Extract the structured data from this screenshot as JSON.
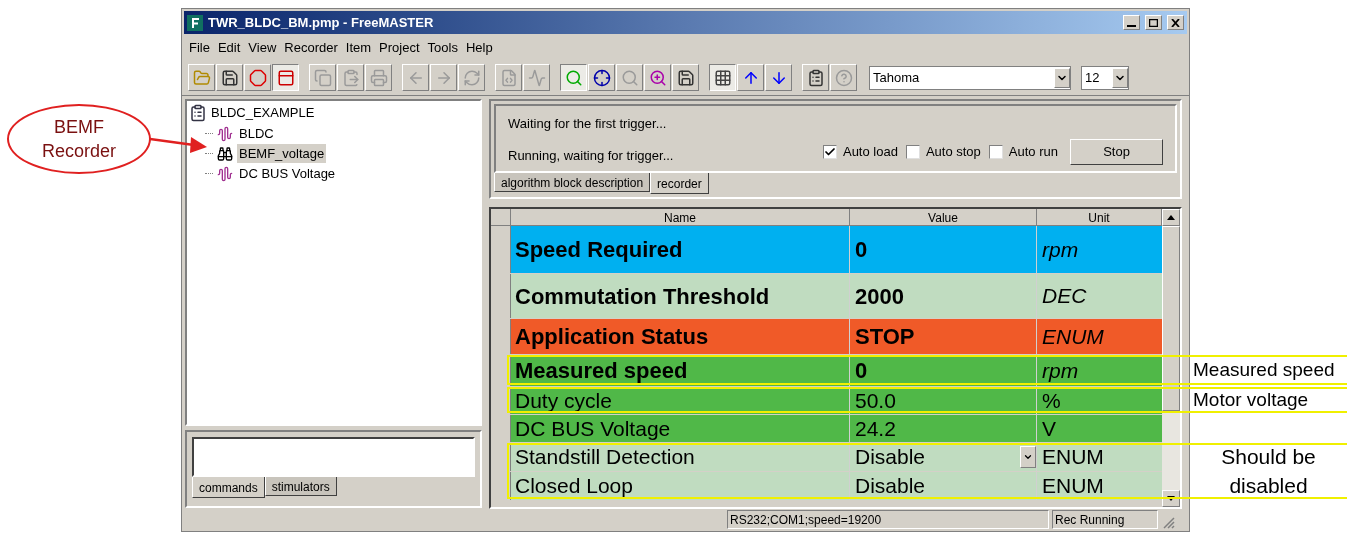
{
  "window": {
    "title": "TWR_BLDC_BM.pmp - FreeMASTER"
  },
  "menu": [
    "File",
    "Edit",
    "View",
    "Recorder",
    "Item",
    "Project",
    "Tools",
    "Help"
  ],
  "toolbar": {
    "buttons": [
      {
        "kind": "open",
        "disabled": false,
        "pressed": false
      },
      {
        "kind": "save",
        "disabled": false,
        "pressed": false
      },
      {
        "kind": "stop",
        "disabled": false,
        "pressed": false
      },
      {
        "kind": "view",
        "disabled": false,
        "pressed": true
      },
      {
        "kind": "copy",
        "disabled": true,
        "pressed": false
      },
      {
        "kind": "paste",
        "disabled": true,
        "pressed": false
      },
      {
        "kind": "print",
        "disabled": true,
        "pressed": false
      },
      {
        "kind": "back",
        "disabled": true,
        "pressed": false
      },
      {
        "kind": "forward",
        "disabled": true,
        "pressed": false
      },
      {
        "kind": "refresh",
        "disabled": true,
        "pressed": false
      },
      {
        "kind": "run",
        "disabled": true,
        "pressed": false
      },
      {
        "kind": "wave",
        "disabled": true,
        "pressed": false
      },
      {
        "kind": "probe",
        "disabled": false,
        "pressed": true
      },
      {
        "kind": "target",
        "disabled": false,
        "pressed": false
      },
      {
        "kind": "probe",
        "disabled": true,
        "pressed": false
      },
      {
        "kind": "zoom",
        "disabled": false,
        "pressed": false
      },
      {
        "kind": "save",
        "disabled": false,
        "pressed": false
      },
      {
        "kind": "grid",
        "disabled": false,
        "pressed": true
      },
      {
        "kind": "up",
        "disabled": false,
        "pressed": false
      },
      {
        "kind": "down",
        "disabled": false,
        "pressed": false
      },
      {
        "kind": "properties",
        "disabled": false,
        "pressed": false
      },
      {
        "kind": "help",
        "disabled": true,
        "pressed": false
      }
    ],
    "font": "Tahoma",
    "font_size": "12"
  },
  "tree": {
    "label": "BLDC_EXAMPLE",
    "children": [
      {
        "label": "BLDC",
        "kind": "recorder",
        "selected": false
      },
      {
        "label": "BEMF_voltage",
        "kind": "binoculars",
        "selected": true
      },
      {
        "label": "DC BUS Voltage",
        "kind": "recorder",
        "selected": false
      }
    ]
  },
  "commands": {
    "tabs": [
      {
        "label": "commands",
        "selected": true
      },
      {
        "label": "stimulators",
        "selected": false
      }
    ]
  },
  "recorder": {
    "messages": [
      "Waiting for the first trigger...",
      "Running, waiting for trigger..."
    ],
    "options": [
      {
        "label": "Auto load",
        "checked": true
      },
      {
        "label": "Auto stop",
        "checked": false
      },
      {
        "label": "Auto run",
        "checked": false
      }
    ],
    "button": "Stop",
    "tabs": [
      {
        "label": "algorithm block description",
        "selected": false
      },
      {
        "label": "recorder",
        "selected": true
      }
    ]
  },
  "table": {
    "columns": [
      "Name",
      "Value",
      "Unit"
    ],
    "rows": [
      {
        "name": "Speed Required",
        "value": "0",
        "unit": "rpm",
        "color": "#00b0f0",
        "emphasis": true,
        "dropdown": false
      },
      {
        "name": "Commutation Threshold",
        "value": "2000",
        "unit": "DEC",
        "color": "#c0dcc0",
        "emphasis": true,
        "dropdown": false
      },
      {
        "name": "Application Status",
        "value": "STOP",
        "unit": "ENUM",
        "color": "#f05a28",
        "emphasis": true,
        "dropdown": false
      },
      {
        "name": "Measured speed",
        "value": "0",
        "unit": "rpm",
        "color": "#50b848",
        "emphasis": true,
        "dropdown": false
      },
      {
        "name": "Duty cycle",
        "value": "50.0",
        "unit": "%",
        "color": "#50b848",
        "emphasis": false,
        "dropdown": false
      },
      {
        "name": "DC BUS Voltage",
        "value": "24.2",
        "unit": "V",
        "color": "#50b848",
        "emphasis": false,
        "dropdown": false
      },
      {
        "name": "Standstill Detection",
        "value": "Disable",
        "unit": "ENUM",
        "color": "#c0dcc0",
        "emphasis": false,
        "dropdown": true
      },
      {
        "name": "Closed Loop",
        "value": "Disable",
        "unit": "ENUM",
        "color": "#c0dcc0",
        "emphasis": false,
        "dropdown": false
      }
    ]
  },
  "status_bar": [
    "RS232;COM1;speed=19200",
    "Rec Running"
  ],
  "annotations": {
    "bubble": [
      "BEMF",
      "Recorder"
    ],
    "callouts": [
      {
        "text": "Measured speed"
      },
      {
        "text": "Motor voltage"
      },
      {
        "text": "Should be disabled"
      }
    ]
  }
}
